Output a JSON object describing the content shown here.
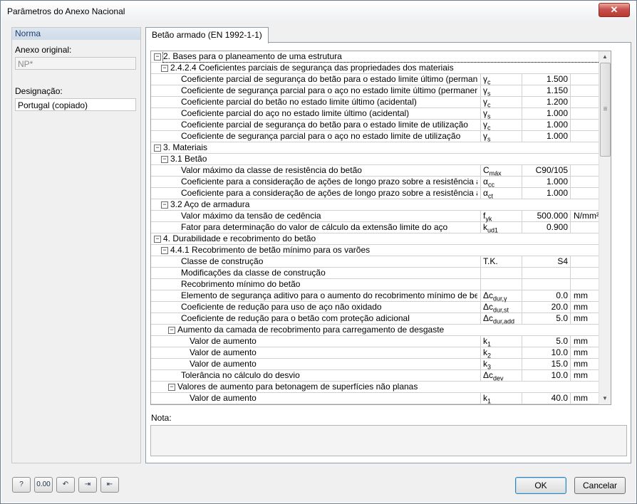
{
  "window": {
    "title": "Parâmetros do Anexo Nacional",
    "close_label": "✕"
  },
  "left": {
    "header": "Norma",
    "anexo_label": "Anexo original:",
    "anexo_value": "NP*",
    "designacao_label": "Designação:",
    "designacao_value": "Portugal (copiado)"
  },
  "tab": {
    "label": "Betão armado (EN 1992-1-1)"
  },
  "tree": {
    "rows": [
      {
        "level": 0,
        "toggle": "−",
        "name": "2. Bases para o planeamento de uma estrutura",
        "sym": "",
        "sub": "",
        "val": "",
        "unit": ""
      },
      {
        "level": 1,
        "toggle": "−",
        "name": "2.4.2.4 Coeficientes parciais de segurança das propriedades dos materiais",
        "sym": "",
        "sub": "",
        "val": "",
        "unit": ""
      },
      {
        "level": 2,
        "toggle": "",
        "name": "Coeficiente parcial de segurança do betão para o estado limite último (permanente, transitório)",
        "sym": "γ",
        "sub": "c",
        "val": "1.500",
        "unit": ""
      },
      {
        "level": 2,
        "toggle": "",
        "name": "Coeficiente de segurança parcial para o aço no estado limite último (permanente, transitório)",
        "sym": "γ",
        "sub": "s",
        "val": "1.150",
        "unit": ""
      },
      {
        "level": 2,
        "toggle": "",
        "name": "Coeficiente parcial do betão no estado limite último (acidental)",
        "sym": "γ",
        "sub": "c",
        "val": "1.200",
        "unit": ""
      },
      {
        "level": 2,
        "toggle": "",
        "name": "Coeficiente parcial do aço no estado limite último (acidental)",
        "sym": "γ",
        "sub": "s",
        "val": "1.000",
        "unit": ""
      },
      {
        "level": 2,
        "toggle": "",
        "name": "Coeficiente parcial de segurança do betão para o estado limite de utilização",
        "sym": "γ",
        "sub": "c",
        "val": "1.000",
        "unit": ""
      },
      {
        "level": 2,
        "toggle": "",
        "name": "Coeficiente de segurança parcial para o aço no estado limite de utilização",
        "sym": "γ",
        "sub": "s",
        "val": "1.000",
        "unit": ""
      },
      {
        "level": 0,
        "toggle": "−",
        "name": "3. Materiais",
        "sym": "",
        "sub": "",
        "val": "",
        "unit": ""
      },
      {
        "level": 1,
        "toggle": "−",
        "name": "3.1 Betão",
        "sym": "",
        "sub": "",
        "val": "",
        "unit": ""
      },
      {
        "level": 2,
        "toggle": "",
        "name": "Valor máximo da classe de resistência do betão",
        "sym": "C",
        "sub": "máx",
        "val": "C90/105",
        "unit": ""
      },
      {
        "level": 2,
        "toggle": "",
        "name": "Coeficiente para a consideração de ações de longo prazo sobre a resistência à compressão",
        "sym": "α",
        "sub": "cc",
        "val": "1.000",
        "unit": ""
      },
      {
        "level": 2,
        "toggle": "",
        "name": "Coeficiente para a consideração de ações de longo prazo sobre a resistência à tração",
        "sym": "α",
        "sub": "ct",
        "val": "1.000",
        "unit": ""
      },
      {
        "level": 1,
        "toggle": "−",
        "name": "3.2 Aço de armadura",
        "sym": "",
        "sub": "",
        "val": "",
        "unit": ""
      },
      {
        "level": 2,
        "toggle": "",
        "name": "Valor máximo da tensão de cedência",
        "sym": "f",
        "sub": "yk",
        "val": "500.000",
        "unit": "N/mm²"
      },
      {
        "level": 2,
        "toggle": "",
        "name": "Fator para determinação do valor de cálculo da extensão limite do aço",
        "sym": "k",
        "sub": "ud1",
        "val": "0.900",
        "unit": ""
      },
      {
        "level": 0,
        "toggle": "−",
        "name": "4. Durabilidade e recobrimento do betão",
        "sym": "",
        "sub": "",
        "val": "",
        "unit": ""
      },
      {
        "level": 1,
        "toggle": "−",
        "name": "4.4.1 Recobrimento de betão mínimo para os varões",
        "sym": "",
        "sub": "",
        "val": "",
        "unit": ""
      },
      {
        "level": 2,
        "toggle": "",
        "name": "Classe de construção",
        "sym": "T.K.",
        "sub": "",
        "val": "S4",
        "unit": ""
      },
      {
        "level": 2,
        "toggle": "",
        "name": "Modificações da classe de construção",
        "sym": "",
        "sub": "",
        "val": "",
        "unit": ""
      },
      {
        "level": 2,
        "toggle": "",
        "name": "Recobrimento mínimo do betão",
        "sym": "",
        "sub": "",
        "val": "",
        "unit": ""
      },
      {
        "level": 2,
        "toggle": "",
        "name": "Elemento de segurança aditivo para o aumento do recobrimento mínimo de betão",
        "sym": "Δc",
        "sub": "dur,γ",
        "val": "0.0",
        "unit": "mm"
      },
      {
        "level": 2,
        "toggle": "",
        "name": "Coeficiente de redução para uso de aço não oxidado",
        "sym": "Δc",
        "sub": "dur,st",
        "val": "20.0",
        "unit": "mm"
      },
      {
        "level": 2,
        "toggle": "",
        "name": "Coeficiente de redução para o betão com proteção adicional",
        "sym": "Δc",
        "sub": "dur,add",
        "val": "5.0",
        "unit": "mm"
      },
      {
        "level": 2,
        "toggle": "−",
        "name": "Aumento da camada de recobrimento para carregamento de desgaste",
        "sym": "",
        "sub": "",
        "val": "",
        "unit": ""
      },
      {
        "level": 3,
        "toggle": "",
        "name": "Valor de aumento",
        "sym": "k",
        "sub": "1",
        "val": "5.0",
        "unit": "mm"
      },
      {
        "level": 3,
        "toggle": "",
        "name": "Valor de aumento",
        "sym": "k",
        "sub": "2",
        "val": "10.0",
        "unit": "mm"
      },
      {
        "level": 3,
        "toggle": "",
        "name": "Valor de aumento",
        "sym": "k",
        "sub": "3",
        "val": "15.0",
        "unit": "mm"
      },
      {
        "level": 2,
        "toggle": "",
        "name": "Tolerância no cálculo do desvio",
        "sym": "Δc",
        "sub": "dev",
        "val": "10.0",
        "unit": "mm"
      },
      {
        "level": 2,
        "toggle": "−",
        "name": "Valores de aumento para betonagem de superfícies não planas",
        "sym": "",
        "sub": "",
        "val": "",
        "unit": ""
      },
      {
        "level": 3,
        "toggle": "",
        "name": "Valor de aumento",
        "sym": "k",
        "sub": "1",
        "val": "40.0",
        "unit": "mm"
      }
    ]
  },
  "note": {
    "label": "Nota:"
  },
  "footer": {
    "tools": [
      {
        "name": "help-icon",
        "glyph": "?"
      },
      {
        "name": "decimal-places-icon",
        "glyph": "0.00"
      },
      {
        "name": "reset-icon",
        "glyph": "↶"
      },
      {
        "name": "export-icon",
        "glyph": "⇥"
      },
      {
        "name": "import-icon",
        "glyph": "⇤"
      }
    ],
    "ok_label": "OK",
    "cancel_label": "Cancelar"
  }
}
